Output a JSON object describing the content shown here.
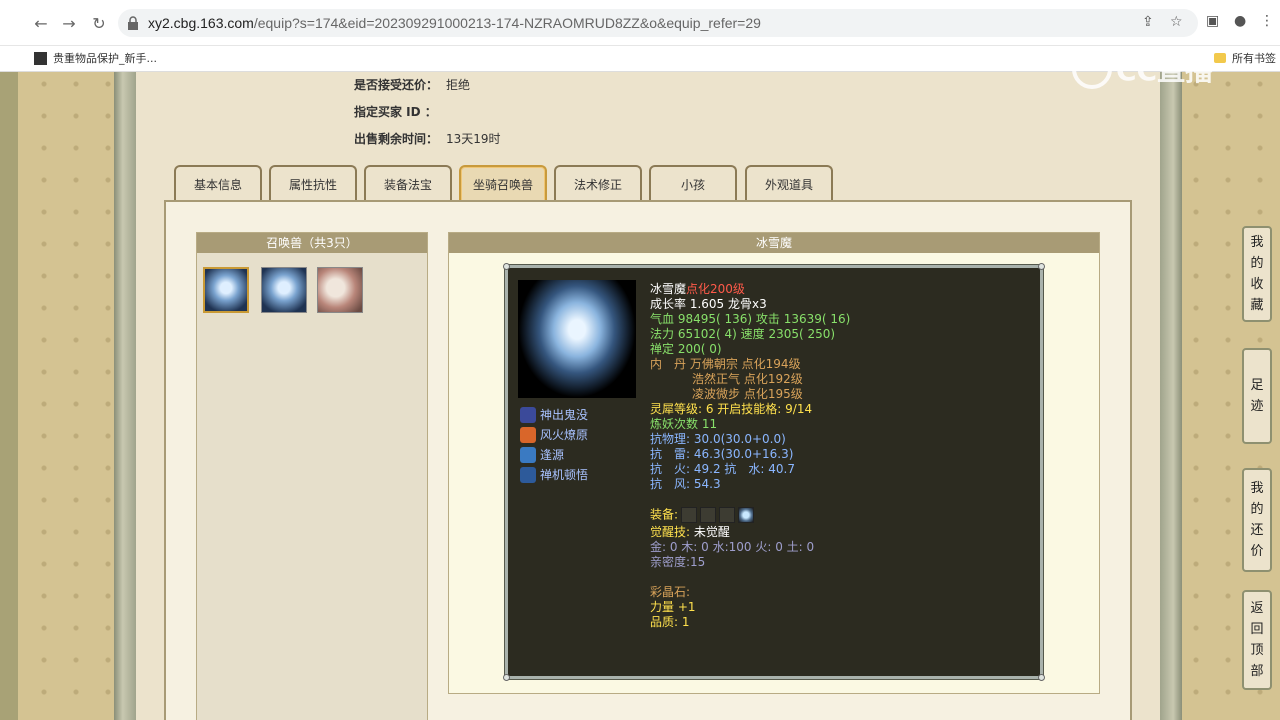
{
  "browser": {
    "url_host": "xy2.cbg.163.com",
    "url_path": "/equip?s=174&eid=202309291000213-174-NZRAOMRUD8ZZ&o&equip_refer=29",
    "bookmark_left": "贵重物品保护_新手...",
    "bookmark_right": "所有书签"
  },
  "watermark": "CC直播",
  "info": [
    {
      "label": "是否接受还价：",
      "value": "拒绝"
    },
    {
      "label": "指定买家 ID ：",
      "value": ""
    },
    {
      "label": "出售剩余时间：",
      "value": "13天19时"
    }
  ],
  "tabs": [
    "基本信息",
    "属性抗性",
    "装备法宝",
    "坐骑召唤兽",
    "法术修正",
    "小孩",
    "外观道具"
  ],
  "active_tab": 3,
  "left_box": {
    "title": "召唤兽（共3只）"
  },
  "right_box": {
    "title": "冰雪魔"
  },
  "pet": {
    "name": "冰雪魔",
    "tag": "点化200级",
    "growth": "成长率 1.605 龙骨x3",
    "hp": "气血 98495( 136) ",
    "atk": "攻击 13639( 16)",
    "mp": "法力 65102( 4) ",
    "spd": "速度 2305( 250)",
    "zen": "禅定 200( 0)",
    "inner_label": "内　丹",
    "inner1": "万佛朝宗 点化194级",
    "inner2": "浩然正气 点化192级",
    "inner3": "凌波微步 点化195级",
    "lingxi": "灵犀等级:  6 开启技能格:  9/14",
    "lianyao": "炼妖次数 11",
    "res1": "抗物理: 30.0(30.0+0.0)",
    "res2": "抗　雷: 46.3(30.0+16.3)",
    "res3": "抗　火: 49.2 抗　水: 40.7",
    "res4": "抗　风: 54.3",
    "equip_label": "装备:",
    "awaken_label": "觉醒技:",
    "awaken_value": "未觉醒",
    "elements": "金: 0 木: 0 水:100 火: 0 土: 0",
    "intimacy": "亲密度:15",
    "gem_label": "彩晶石:",
    "power": "力量 +1",
    "quality": "品质:  1"
  },
  "skills": [
    "神出鬼没",
    "风火燎原",
    "逢源",
    "禅机顿悟"
  ],
  "side_buttons": [
    "我的收藏",
    "足迹",
    "我的还价",
    "返回顶部"
  ]
}
